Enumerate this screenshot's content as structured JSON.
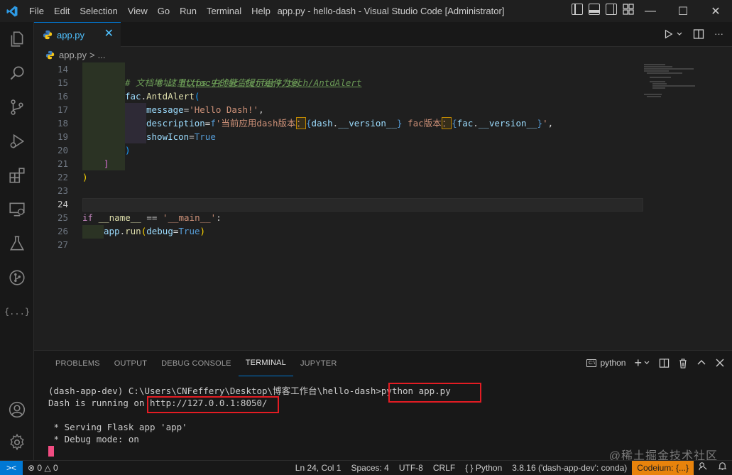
{
  "titlebar": {
    "menu": [
      "File",
      "Edit",
      "Selection",
      "View",
      "Go",
      "Run",
      "Terminal",
      "Help"
    ],
    "window_title": "app.py - hello-dash - Visual Studio Code [Administrator]",
    "minimize": "—",
    "maximize": "☐",
    "close": "✕"
  },
  "tab": {
    "label": "app.py",
    "close": "✕"
  },
  "breadcrumb": {
    "file": "app.py",
    "sep": ">",
    "more": "..."
  },
  "editor": {
    "line_numbers": [
      "14",
      "15",
      "16",
      "17",
      "18",
      "19",
      "20",
      "21",
      "22",
      "23",
      "24",
      "25",
      "26",
      "27"
    ],
    "active_line": "24",
    "comment1": "# 这里以fac中的警告提示组件为例",
    "comment2_prefix": "# 文档地址：",
    "comment2_link": "https://fac.feffery.tech/AntdAlert",
    "l16_obj": "fac",
    "l16_dot": ".",
    "l16_fn": "AntdAlert",
    "l16_paren": "(",
    "l17_key": "message",
    "l17_eq": "=",
    "l17_str": "'Hello Dash!'",
    "l17_comma": ",",
    "l18_key": "description",
    "l18_eq": "=",
    "l18_f": "f",
    "l18_s1": "'当前应用dash版本",
    "l18_colon1": "：",
    "l18_b1": "{",
    "l18_v1": "dash",
    "l18_d1": ".",
    "l18_attr1": "__version__",
    "l18_b2": "}",
    "l18_s2": " fac版本",
    "l18_colon2": "：",
    "l18_b3": "{",
    "l18_v2": "fac",
    "l18_d2": ".",
    "l18_attr2": "__version__",
    "l18_b4": "}",
    "l18_s3": "'",
    "l18_comma": ",",
    "l19_key": "showIcon",
    "l19_eq": "=",
    "l19_val": "True",
    "l20": ")",
    "l21": "]",
    "l22": ")",
    "l25_if": "if",
    "l25_name": "__name__",
    "l25_op": " == ",
    "l25_str": "'__main__'",
    "l25_colon": ":",
    "l26_obj": "app",
    "l26_dot": ".",
    "l26_fn": "run",
    "l26_p1": "(",
    "l26_key": "debug",
    "l26_eq": "=",
    "l26_val": "True",
    "l26_p2": ")"
  },
  "panel": {
    "tabs": [
      "PROBLEMS",
      "OUTPUT",
      "DEBUG CONSOLE",
      "TERMINAL",
      "JUPYTER"
    ],
    "active_tab": "TERMINAL",
    "terminal_name": "python",
    "add": "+",
    "terminal": {
      "line1_prompt": "(dash-app-dev) C:\\Users\\CNFeffery\\Desktop\\博客工作台\\hello-dash>",
      "line1_cmd": "python app.py",
      "line2_prefix": "Dash is running on ",
      "line2_url": "http://127.0.0.1:8050/",
      "line3": " * Serving Flask app 'app'",
      "line4": " * Debug mode: on"
    },
    "watermark": "@稀土掘金技术社区"
  },
  "statusbar": {
    "remote": "><",
    "errors": "0",
    "warnings": "0",
    "position": "Ln 24, Col 1",
    "spaces": "Spaces: 4",
    "encoding": "UTF-8",
    "eol": "CRLF",
    "language": "Python",
    "interpreter": "3.8.16 ('dash-app-dev': conda)",
    "codeium": "Codeium: {...}"
  },
  "colors": {
    "accent": "#0078d4",
    "highlight_box": "#e31c23",
    "cursor": "#f14c81",
    "codeium": "#e8830c"
  }
}
